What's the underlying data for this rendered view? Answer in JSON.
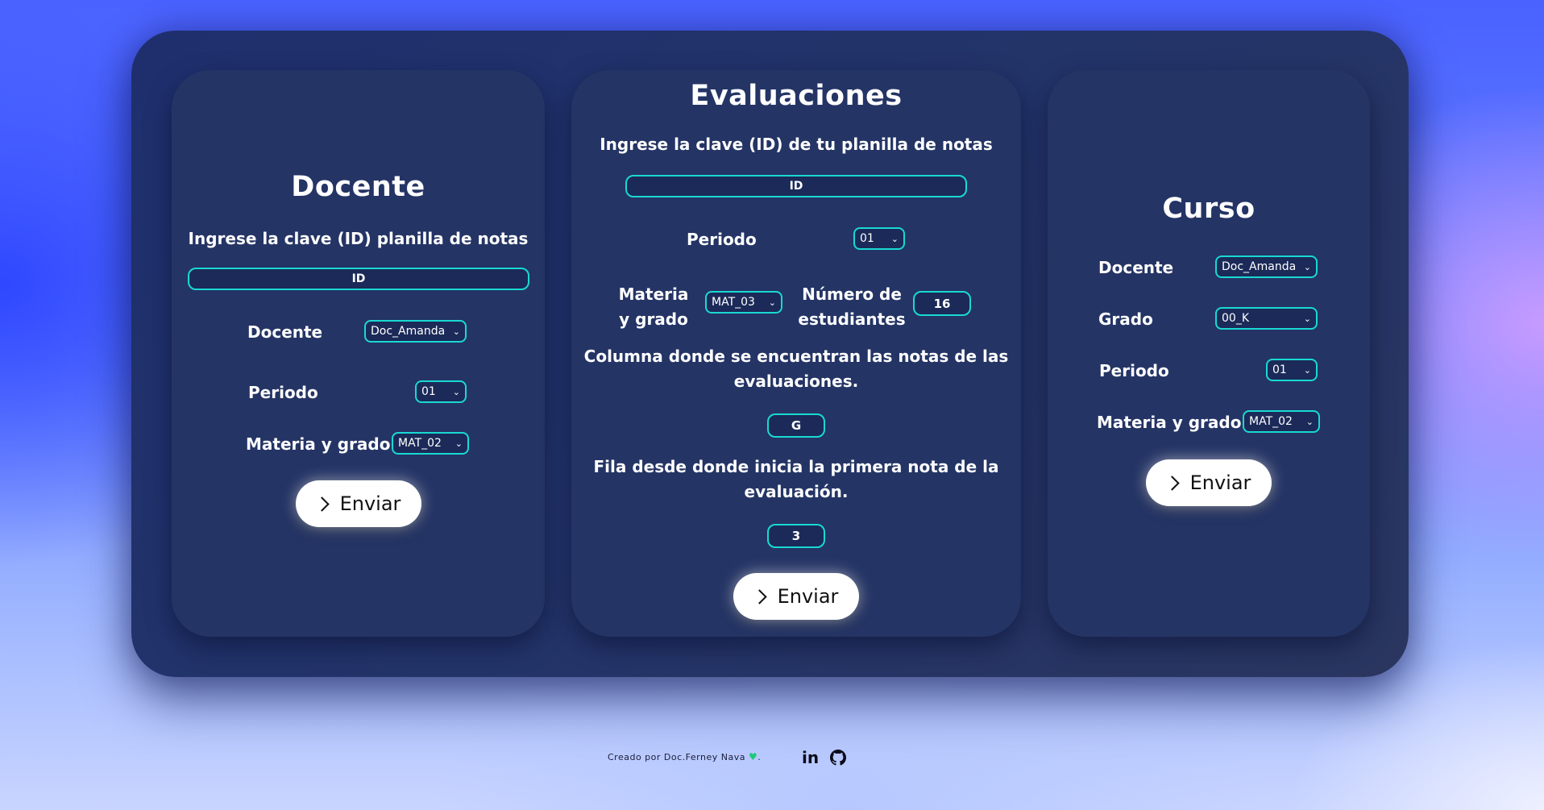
{
  "docente_card": {
    "title": "Docente",
    "instruction": "Ingrese la clave (ID) planilla de notas",
    "id_placeholder": "ID",
    "docente_label": "Docente",
    "docente_value": "Doc_Amanda",
    "periodo_label": "Periodo",
    "periodo_value": "01",
    "materia_label": "Materia y grado",
    "materia_value": "MAT_02",
    "button_label": "Enviar"
  },
  "evaluaciones_card": {
    "title": "Evaluaciones",
    "instruction": "Ingrese la clave (ID) de tu planilla de notas",
    "id_placeholder": "ID",
    "periodo_label": "Periodo",
    "periodo_value": "01",
    "materia_label_line1": "Materia",
    "materia_label_line2": "y grado",
    "materia_value": "MAT_03",
    "estudiantes_label_line1": "Número de",
    "estudiantes_label_line2": "estudiantes",
    "estudiantes_value": "16",
    "columna_label_line1": "Columna donde se encuentran las notas de las",
    "columna_label_line2": "evaluaciones.",
    "columna_value": "G",
    "fila_label_line1": "Fila desde donde inicia la primera nota de la",
    "fila_label_line2": "evaluación.",
    "fila_value": "3",
    "button_label": "Enviar"
  },
  "curso_card": {
    "title": "Curso",
    "docente_label": "Docente",
    "docente_value": "Doc_Amanda",
    "grado_label": "Grado",
    "grado_value": "00_K",
    "periodo_label": "Periodo",
    "periodo_value": "01",
    "materia_label": "Materia y grado",
    "materia_value": "MAT_02",
    "button_label": "Enviar"
  },
  "footer": {
    "credit": "Creado por Doc.Ferney Nava",
    "heart": "♥",
    "period": ".",
    "linkedin": "in",
    "github_icon": "github-icon"
  },
  "colors": {
    "accent": "#19d9d2",
    "card": "#243465",
    "panel": "#1f2f6e"
  }
}
